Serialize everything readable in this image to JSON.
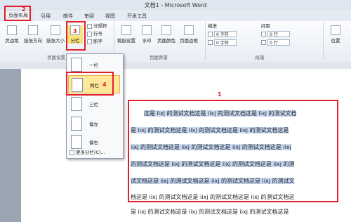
{
  "window": {
    "title": "文档1 - Microsoft Word"
  },
  "tabs": [
    {
      "label": "页面布局",
      "active": true
    },
    {
      "label": "引用"
    },
    {
      "label": "邮件"
    },
    {
      "label": "审阅"
    },
    {
      "label": "视图"
    },
    {
      "label": "开发工具"
    }
  ],
  "ribbon": {
    "page_setup": {
      "label": "页面设置",
      "margins": "页边距",
      "orientation": "纸张方向",
      "size": "纸张大小",
      "columns": "分栏",
      "breaks": "分隔符",
      "line_numbers": "行号",
      "hyphenation": "断字"
    },
    "page_background": {
      "label": "页面背景",
      "manuscript": "稿纸设置",
      "watermark": "水印",
      "page_color": "页面颜色",
      "page_borders": "页面边框"
    },
    "paragraph": {
      "label": "段落",
      "indent_title": "缩进",
      "spacing_title": "间距",
      "left_value": "0 字符",
      "right_value": "0 字符",
      "before_value": "0 行",
      "after_value": "0 行"
    },
    "arrange": {
      "position": "位置"
    }
  },
  "columns_menu": {
    "items": [
      {
        "label": "一栏"
      },
      {
        "label": "两栏"
      },
      {
        "label": "三栏"
      },
      {
        "label": "偏左"
      },
      {
        "label": "偏右"
      }
    ],
    "more": "更多分栏(C)..."
  },
  "annotations": {
    "n1": "1",
    "n2": "2",
    "n3": "3",
    "n4": "4"
  },
  "document": {
    "lines": [
      "这是 iixj 的测试文档这是 iixj 的测试文档这是 iixj 的测试文档",
      "是 iixj 的测试文档这是 iixj 的测试文档这是 iixj 的测试文档这是",
      "iixj 的测试文档这是 iixj 的测试文档这是 iixj 的测试文档这是 iixj",
      "的测试文档这是 iixj 的测试文档这是 iixj 的测试文档这是 iixj 的测",
      "试文档这是 iixj 的测试文档这是 iixj 的测试文档这是 iixj 的测试文",
      "档这是 iixj 的测试文档这是 iixj 的测试文档这是 iixj 的测试文档这",
      "是 iixj 的测试文档这是 iixj 的测试文档这是 iixj 的测试文档这是"
    ]
  }
}
